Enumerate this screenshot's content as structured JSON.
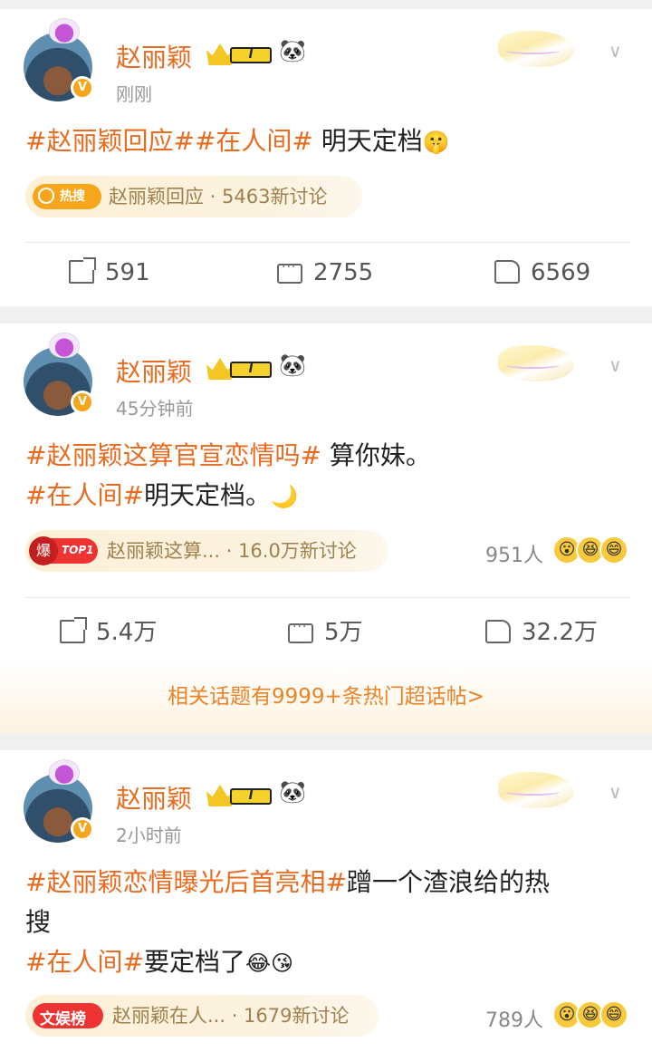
{
  "posts": [
    {
      "username": "赵丽颖",
      "level": "I",
      "time": "刚刚",
      "text_topic1": "#赵丽颖回应#",
      "text_topic2": "#在人间#",
      "text_plain": " 明天定档",
      "pill_tag": "热搜",
      "pill_text": "赵丽颖回应 · 5463新讨论",
      "reposts": "591",
      "comments": "2755",
      "likes": "6569"
    },
    {
      "username": "赵丽颖",
      "level": "I",
      "time": "45分钟前",
      "line1_topic": "#赵丽颖这算官宣恋情吗#",
      "line1_plain": " 算你妹。",
      "line2_topic": "#在人间#",
      "line2_plain": "明天定档。",
      "pill_badge": "爆",
      "pill_tag": "TOP1",
      "pill_text": "赵丽颖这算... · 16.0万新讨论",
      "people": "951人",
      "reposts": "5.4万",
      "comments": "5万",
      "likes": "32.2万"
    },
    {
      "username": "赵丽颖",
      "level": "I",
      "time": "2小时前",
      "line1_topic": "#赵丽颖恋情曝光后首亮相#",
      "line1_plain": "蹭一个渣浪给的热",
      "line2_plain": "搜",
      "line3_topic": "#在人间#",
      "line3_plain": "要定档了",
      "pill_tag": "文娱榜",
      "pill_text": "赵丽颖在人... · 1679新讨论",
      "people": "789人"
    }
  ],
  "related": "相关话题有9999+条热门超话帖>",
  "colors": {
    "accent": "#e86b1f",
    "topic": "#e86b1f",
    "link": "#e8852a",
    "badge": "#f7a61b"
  },
  "icons": [
    "verified-badge-icon",
    "crown-level-icon",
    "panda-icon",
    "chevron-down-icon",
    "repost-icon",
    "comment-icon",
    "like-icon",
    "search-icon"
  ]
}
